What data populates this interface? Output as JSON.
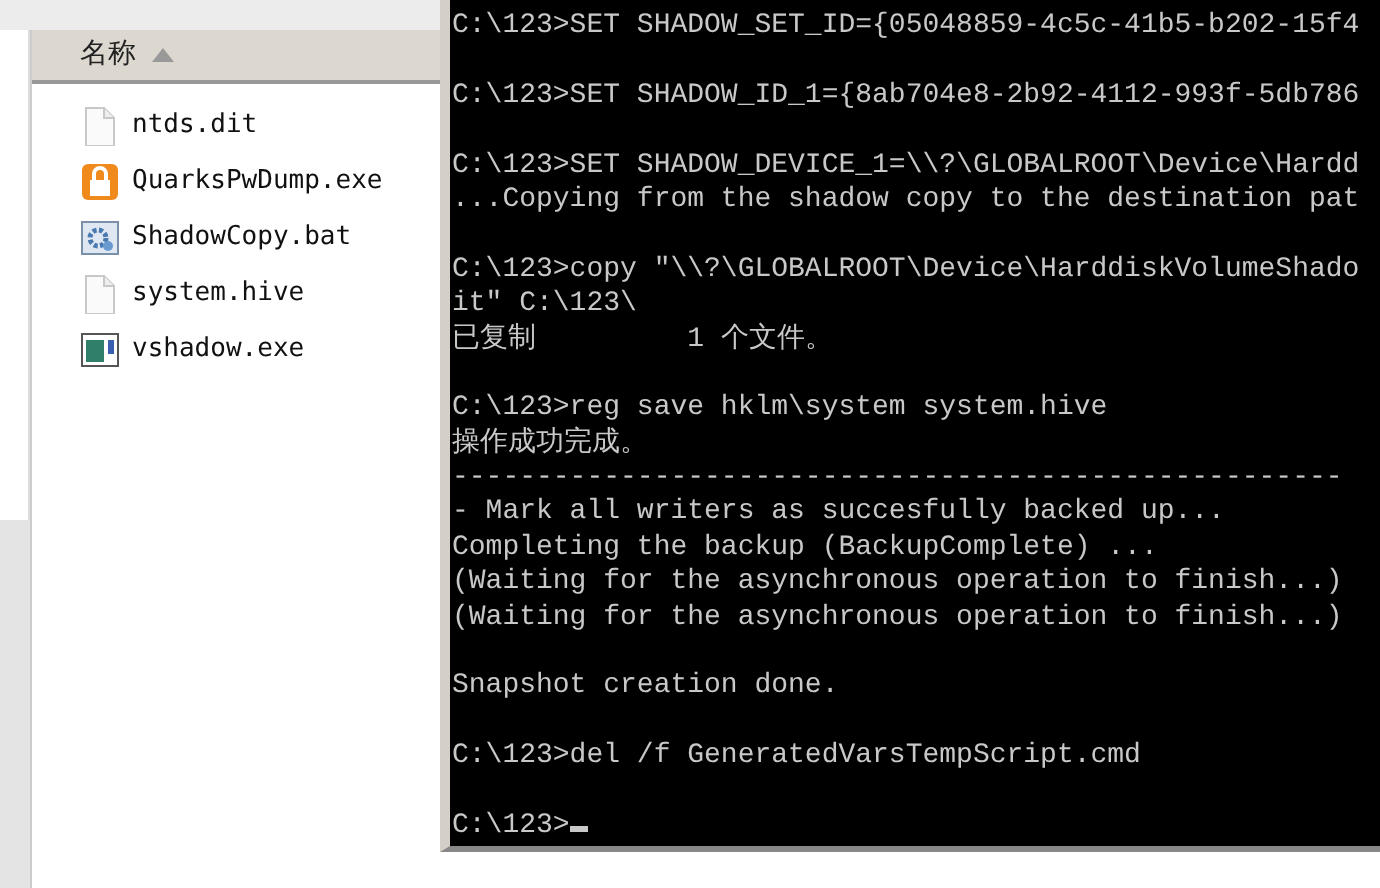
{
  "explorer": {
    "column_header": "名称",
    "files": [
      {
        "name": "ntds.dit",
        "kind": "blank"
      },
      {
        "name": "QuarksPwDump.exe",
        "kind": "lock"
      },
      {
        "name": "ShadowCopy.bat",
        "kind": "script"
      },
      {
        "name": "system.hive",
        "kind": "blank"
      },
      {
        "name": "vshadow.exe",
        "kind": "app"
      }
    ]
  },
  "console": {
    "cursor": true,
    "paragraphs": [
      [
        "C:\\123>SET SHADOW_SET_ID={05048859-4c5c-41b5-b202-15f4"
      ],
      [
        "C:\\123>SET SHADOW_ID_1={8ab704e8-2b92-4112-993f-5db786"
      ],
      [
        "C:\\123>SET SHADOW_DEVICE_1=\\\\?\\GLOBALROOT\\Device\\Hardd",
        "...Copying from the shadow copy to the destination pat"
      ],
      [
        "C:\\123>copy \"\\\\?\\GLOBALROOT\\Device\\HarddiskVolumeShado",
        "it\" C:\\123\\",
        "已复制         1 个文件。"
      ],
      [
        "C:\\123>reg save hklm\\system system.hive",
        "操作成功完成。",
        "-----------------------------------------------------",
        "- Mark all writers as succesfully backed up...",
        "Completing the backup (BackupComplete) ...",
        "(Waiting for the asynchronous operation to finish...)",
        "(Waiting for the asynchronous operation to finish...)"
      ],
      [
        "Snapshot creation done."
      ],
      [
        "C:\\123>del /f GeneratedVarsTempScript.cmd"
      ],
      [
        "C:\\123>"
      ]
    ]
  }
}
